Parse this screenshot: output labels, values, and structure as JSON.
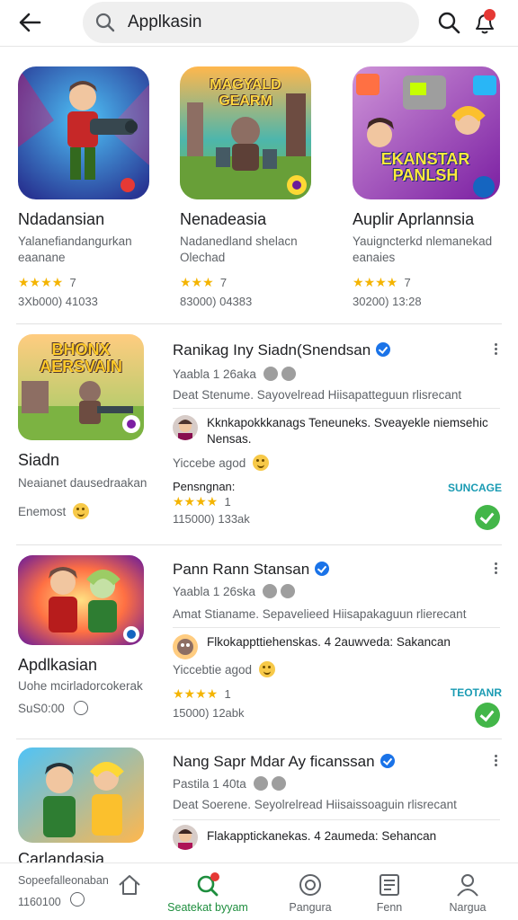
{
  "search": {
    "query": "Applkasin"
  },
  "colors": {
    "accent": "#1e8e3e",
    "badge_red": "#e53935",
    "star": "#f4b400",
    "tag": "#1a9bb3",
    "verified": "#1a73e8"
  },
  "icons": {
    "back": "arrow-left-icon",
    "search": "search-icon",
    "notifications": "notification-bell-icon"
  },
  "featured": [
    {
      "art_text": "",
      "title": "Ndadansian",
      "sub": "Yalanefiandangurkan eaanane",
      "stars": "★★★★",
      "rating": "7",
      "meta": "3Xb000)  41033"
    },
    {
      "art_text": "MAGYALD GEARM",
      "title": "Nenadeasia",
      "sub": "Nadanedland shelacn Olechad",
      "stars": "★★★",
      "rating": "7",
      "meta": "83000)  04383"
    },
    {
      "art_text": "EKANSTAR PANLSH",
      "title": "Auplir Aprlannsia",
      "sub": "Yauigncterkd nlemanekad eanaies",
      "stars": "★★★★",
      "rating": "7",
      "meta": "30200)  13:28"
    }
  ],
  "items": [
    {
      "art_text": "BHONX AERSVAIN",
      "app_name": "Siadn",
      "app_sub": "Neaianet dausedraakan",
      "app_extra": "Enemost",
      "title": "Ranikag Iny Siadn(Snendsan",
      "line2": "Yaabla 1 26aka",
      "desc": "Deat Stenume. Sayovelread Hiisapatteguun rlisrecant",
      "review": "Kknkapokkkanags Teneuneks. Sveayekle niemsehic Nensas.",
      "reply": "Yiccebe agod",
      "stat_label": "Pensngnan:",
      "stars": "★★★★",
      "rating": "1",
      "meta": "115000)  133ak",
      "tag": "SUNCAGE"
    },
    {
      "art_text": "",
      "app_name": "Apdlkasian",
      "app_sub": "Uohe mcirladorcokerak",
      "app_extra": "SuS0:00",
      "title": "Pann Rann Stansan",
      "line2": "Yaabla 1 26ska",
      "desc": "Amat Stianame. Sepavelieed Hiisapakaguun rlierecant",
      "review": "Flkokappttiehenskas. 4 2auwveda: Sakancan",
      "reply": "Yiccebtie agod",
      "stat_label": "",
      "stars": "★★★★",
      "rating": "1",
      "meta": "15000)  12abk",
      "tag": "TEOTANR"
    },
    {
      "art_text": "",
      "app_name": "Carlandasia",
      "app_sub": "",
      "app_extra": "",
      "title": "Nang Sapr Mdar Ay ficanssan",
      "line2": "Pastila 1 40ta",
      "desc": "Deat Soerene. Seyolrelread Hiisaissoaguin rlisrecant",
      "review": "Flakapptickanekas. 4 2aumeda: Sehancan",
      "reply": "",
      "stat_label": "",
      "stars": "",
      "rating": "",
      "meta": "",
      "tag": ""
    }
  ],
  "bottom": {
    "left_title": "Sopeefalleonaban",
    "left_value": "1160100",
    "nav": [
      {
        "label": "",
        "icon": "home-icon"
      },
      {
        "label": "Seatekat byyam",
        "icon": "search-badge-icon"
      },
      {
        "label": "Pangura",
        "icon": "target-icon"
      },
      {
        "label": "Fenn",
        "icon": "document-icon"
      },
      {
        "label": "Nargua",
        "icon": "person-icon"
      }
    ]
  }
}
